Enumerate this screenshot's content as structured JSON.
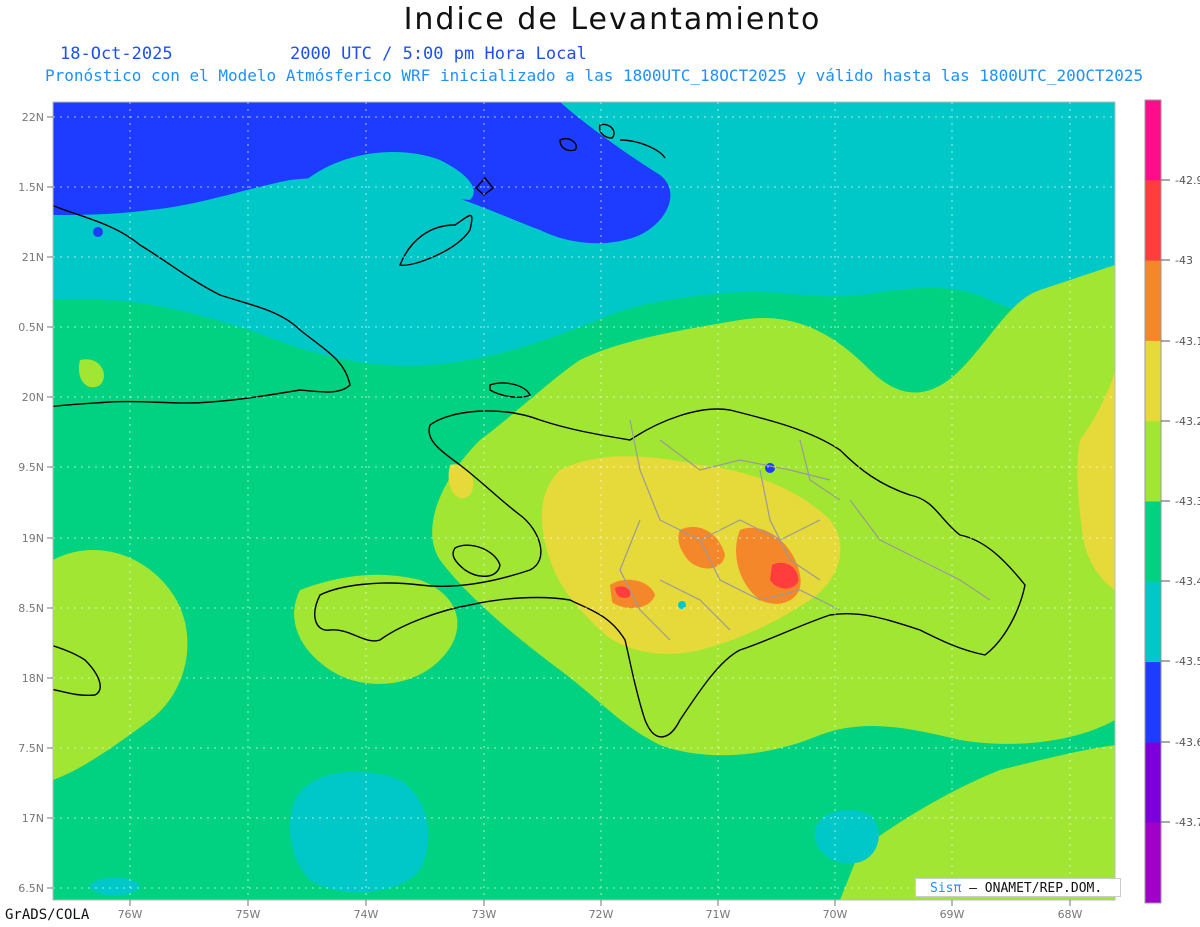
{
  "title": "Indice de Levantamiento",
  "date": "18-Oct-2025",
  "time": "2000 UTC / 5:00 pm Hora Local",
  "subtitle": "Pronóstico con el Modelo Atmósferico WRF inicializado a las 1800UTC_18OCT2025 y válido hasta las  1800UTC_20OCT2025",
  "lat_labels": [
    "22N",
    "1.5N",
    "21N",
    "0.5N",
    "20N",
    "9.5N",
    "19N",
    "8.5N",
    "18N",
    "7.5N",
    "17N",
    "6.5N"
  ],
  "lon_labels": [
    "76W",
    "75W",
    "74W",
    "73W",
    "72W",
    "71W",
    "70W",
    "69W",
    "68W"
  ],
  "colorbar": {
    "labels": [
      "-42.9",
      "-43",
      "-43.1",
      "-43.2",
      "-43.3",
      "-43.4",
      "-43.5",
      "-43.6",
      "-43.7"
    ],
    "colors": [
      "#ff0c8c",
      "#ff3d3d",
      "#f5872b",
      "#e6d93a",
      "#a0e632",
      "#00d282",
      "#00c8c8",
      "#1e3cff",
      "#7d00dc",
      "#a000c8"
    ]
  },
  "credit": "GrADS/COLA",
  "logo": {
    "sis": "Sisπ",
    "text": "– ONAMET/REP.DOM."
  },
  "colors": {
    "ocean_green": "#00d282",
    "lime": "#a0e632",
    "cyan": "#00c8c8",
    "blue": "#1e3cff",
    "yellow": "#e6d93a",
    "orange": "#f5872b",
    "red": "#ff3d3d"
  }
}
